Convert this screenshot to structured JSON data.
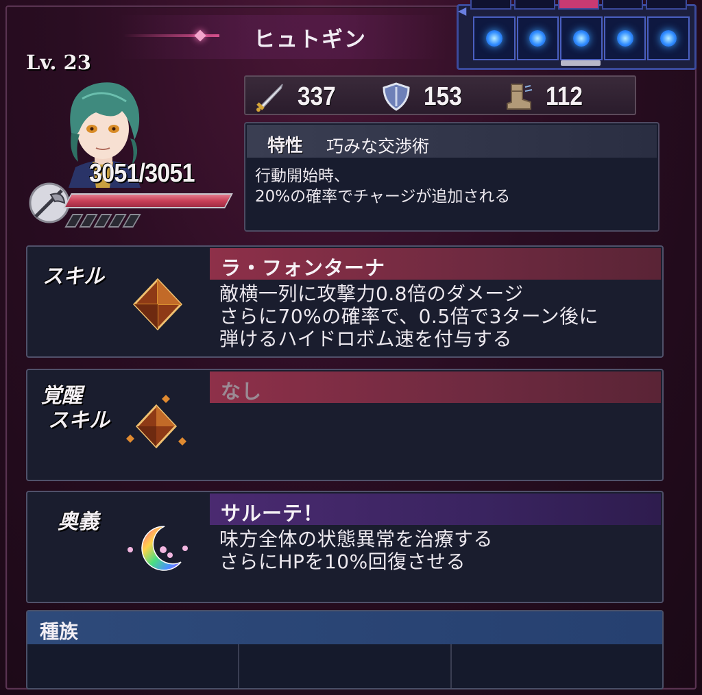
{
  "header": {
    "character_name": "ヒュトギン",
    "team_slots": 5,
    "active_top_cell": 3
  },
  "character": {
    "level": "Lv. 23",
    "hp_text": "3051/3051",
    "hp_fraction": 1.0,
    "charge_pips": 5
  },
  "stats": {
    "attack": "337",
    "defense": "153",
    "speed": "112"
  },
  "trait": {
    "tag": "特性",
    "name": "巧みな交渉術",
    "desc_line1": "行動開始時、",
    "desc_line2": "20%の確率でチャージが追加される"
  },
  "skill": {
    "label": "スキル",
    "title": "ラ・フォンターナ",
    "desc_line1": "敵横一列に攻撃力0.8倍のダメージ",
    "desc_line2": "さらに70%の確率で、0.5倍で3ターン後に",
    "desc_line3": "弾けるハイドロボム速を付与する"
  },
  "awakening": {
    "label_line1": "覚醒",
    "label_line2": "スキル",
    "title": "なし"
  },
  "ougi": {
    "label": "奥義",
    "title": "サルーテ！",
    "desc_line1": "味方全体の状態異常を治療する",
    "desc_line2": "さらにHPを10%回復させる"
  },
  "tribe": {
    "title": "種族",
    "cells": [
      "",
      "",
      ""
    ]
  },
  "colors": {
    "skill_header": "#8e3049",
    "ougi_header": "#4a2a70",
    "tribe_header": "#2e4a7a",
    "slot_glow": "#3aa0ff",
    "hp_fill": "#c94058"
  }
}
